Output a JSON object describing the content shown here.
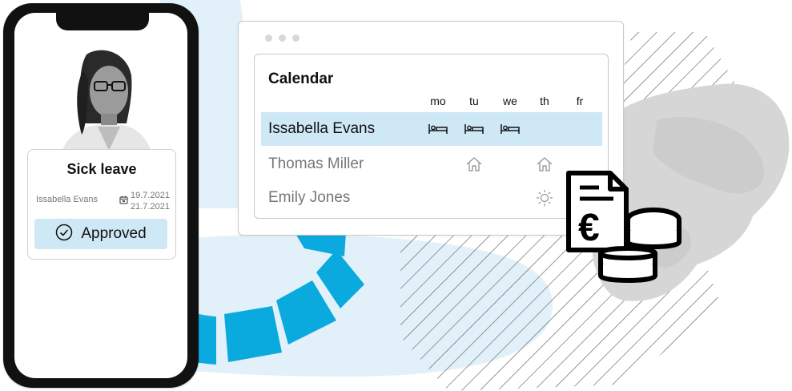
{
  "colors": {
    "accent_blue": "#0aa9de",
    "light_blue": "#cfe8f6",
    "pale_blue": "#e2f1f9",
    "gray_blob": "#d6d6d6"
  },
  "leave_card": {
    "title": "Sick leave",
    "employee": "Issabella Evans",
    "date_from": "19.7.2021",
    "date_to": "21.7.2021",
    "status": "Approved",
    "status_icon": "check-circle-icon",
    "date_icon": "calendar-icon"
  },
  "calendar": {
    "title": "Calendar",
    "days": [
      "mo",
      "tu",
      "we",
      "th",
      "fr"
    ],
    "rows": [
      {
        "name": "Issabella Evans",
        "highlight": true,
        "icons": [
          "bed-icon",
          "bed-icon",
          "bed-icon",
          "",
          ""
        ]
      },
      {
        "name": "Thomas Miller",
        "highlight": false,
        "icons": [
          "",
          "home-icon",
          "",
          "home-icon",
          ""
        ]
      },
      {
        "name": "Emily Jones",
        "highlight": false,
        "icons": [
          "",
          "",
          "",
          "sun-icon",
          ""
        ]
      }
    ]
  },
  "decor": {
    "invoice_icon": "euro-invoice-icon",
    "coins_icon": "coin-stack-icon",
    "portrait": "employee-portrait"
  }
}
